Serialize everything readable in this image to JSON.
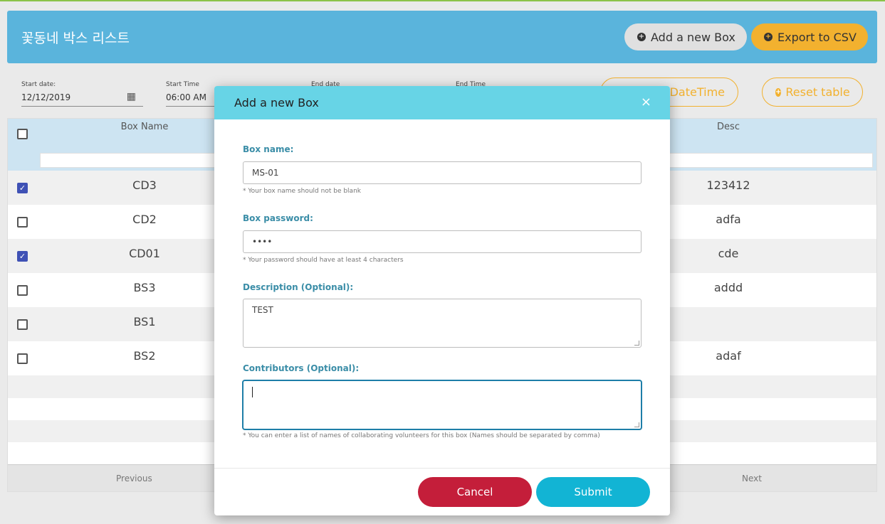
{
  "header": {
    "title": "꽃동네 박스 리스트",
    "add_label": "Add a new Box",
    "export_label": "Export to CSV"
  },
  "filters": {
    "start_date_label": "Start date:",
    "start_date_value": "12/12/2019",
    "start_time_label": "Start Time",
    "start_time_value": "06:00 AM",
    "end_date_label": "End date",
    "end_time_label": "End Time",
    "datetime_label": "DateTime",
    "reset_label": "Reset table"
  },
  "table": {
    "col_box_name": "Box Name",
    "col_desc": "Desc",
    "rows": [
      {
        "name": "CD3",
        "desc": "123412",
        "checked": true
      },
      {
        "name": "CD2",
        "desc": "adfa",
        "checked": false
      },
      {
        "name": "CD01",
        "desc": "cde",
        "checked": true
      },
      {
        "name": "BS3",
        "desc": "addd",
        "checked": false
      },
      {
        "name": "BS1",
        "desc": "",
        "checked": false
      },
      {
        "name": "BS2",
        "desc": "adaf",
        "checked": false
      }
    ],
    "prev_label": "Previous",
    "next_label": "Next"
  },
  "modal": {
    "title": "Add a new Box",
    "close_glyph": "×",
    "box_name_label": "Box name:",
    "box_name_value": "MS-01",
    "box_name_hint": "* Your box name should not be blank",
    "password_label": "Box password:",
    "password_value": "••••",
    "password_hint": "* Your password should have at least 4 characters",
    "description_label": "Description (Optional):",
    "description_value": "TEST",
    "contributors_label": "Contributors (Optional):",
    "contributors_value": "",
    "contributors_hint": "* You can enter a list of names of collaborating volunteers for this box (Names should be separated by comma)",
    "cancel_label": "Cancel",
    "submit_label": "Submit"
  },
  "colors": {
    "header_bg": "#5ab4dc",
    "export_bg": "#f2b12f",
    "modal_header": "#67d4e6",
    "cancel_bg": "#c41e3a",
    "submit_bg": "#12b4d4",
    "label_color": "#3a8da7"
  }
}
